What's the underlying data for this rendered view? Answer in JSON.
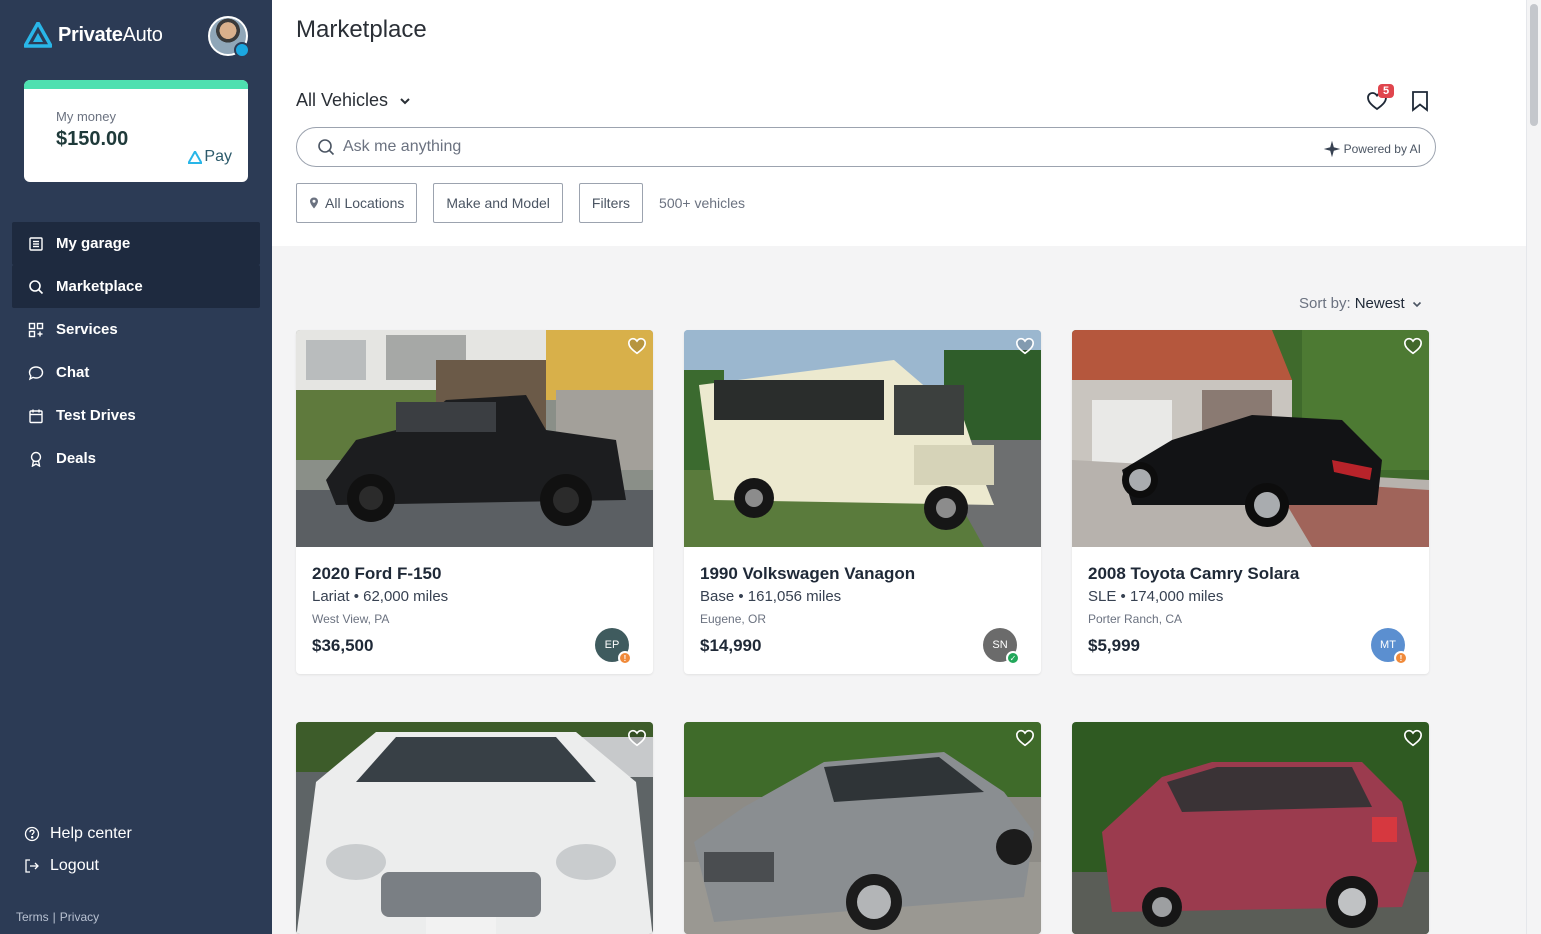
{
  "brand": {
    "name_bold": "Private",
    "name_light": "Auto",
    "accent": "#1ba7e0"
  },
  "wallet": {
    "label": "My money",
    "amount": "$150.00",
    "pay_brand": "Pay"
  },
  "sidebar": {
    "items": [
      {
        "label": "My garage",
        "icon": "garage-icon"
      },
      {
        "label": "Marketplace",
        "icon": "search-icon"
      },
      {
        "label": "Services",
        "icon": "grid-icon"
      },
      {
        "label": "Chat",
        "icon": "chat-icon"
      },
      {
        "label": "Test Drives",
        "icon": "calendar-icon"
      },
      {
        "label": "Deals",
        "icon": "ribbon-icon"
      }
    ],
    "help": "Help center",
    "logout": "Logout",
    "terms": "Terms",
    "privacy": "Privacy",
    "separator": "|"
  },
  "header": {
    "title": "Marketplace",
    "vehicle_filter": "All Vehicles",
    "favorites_count": "5"
  },
  "search": {
    "placeholder": "Ask me anything",
    "powered": "Powered by AI"
  },
  "filters": {
    "locations": "All Locations",
    "make_model": "Make and Model",
    "filters": "Filters",
    "count": "500+ vehicles"
  },
  "sort": {
    "label": "Sort by:",
    "value": "Newest"
  },
  "listings": [
    {
      "title": "2020 Ford F-150",
      "sub": "Lariat • 62,000 miles",
      "location": "West View, PA",
      "price": "$36,500",
      "seller": "EP",
      "seller_color": "#3f5b5e",
      "badge": "!",
      "badge_color": "#f08a3a"
    },
    {
      "title": "1990 Volkswagen Vanagon",
      "sub": "Base • 161,056 miles",
      "location": "Eugene, OR",
      "price": "$14,990",
      "seller": "SN",
      "seller_color": "#6b6b6b",
      "badge": "✓",
      "badge_color": "#22a75a"
    },
    {
      "title": "2008 Toyota Camry Solara",
      "sub": "SLE • 174,000 miles",
      "location": "Porter Ranch, CA",
      "price": "$5,999",
      "seller": "MT",
      "seller_color": "#5b8fd0",
      "badge": "!",
      "badge_color": "#f08a3a"
    }
  ]
}
